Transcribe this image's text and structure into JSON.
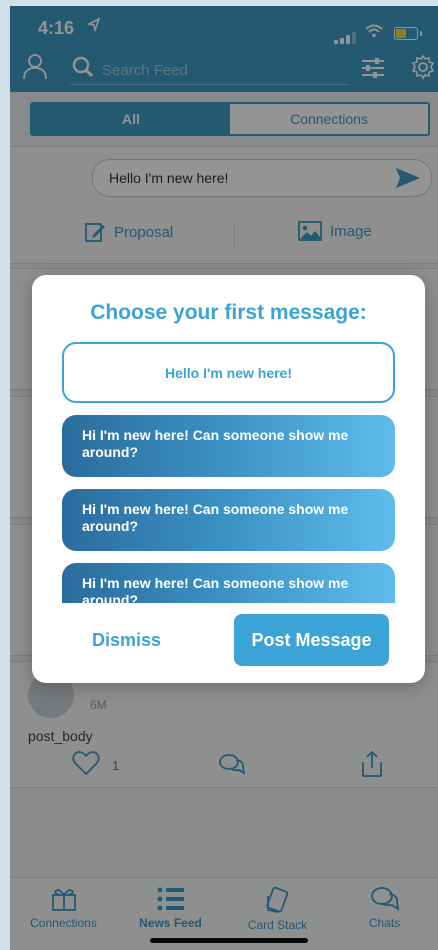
{
  "status_bar": {
    "time": "4:16"
  },
  "header": {
    "search_placeholder": "Search Feed"
  },
  "segments": [
    {
      "label": "All",
      "active": true
    },
    {
      "label": "Connections",
      "active": false
    }
  ],
  "composer": {
    "text": "Hello I'm new here!",
    "attachments": [
      {
        "label": "Proposal",
        "icon": "edit-document-icon"
      },
      {
        "label": "Image",
        "icon": "image-icon"
      }
    ]
  },
  "post": {
    "time_ago": "6M",
    "body": "post_body",
    "like_count": "1"
  },
  "tabbar": {
    "tabs": [
      {
        "label": "Connections",
        "icon": "gift-icon",
        "active": false
      },
      {
        "label": "News Feed",
        "icon": "list-icon",
        "active": true
      },
      {
        "label": "Card Stack",
        "icon": "cards-icon",
        "active": false
      },
      {
        "label": "Chats",
        "icon": "chat-bubbles-icon",
        "active": false
      }
    ]
  },
  "modal": {
    "title": "Choose your first message:",
    "options": [
      {
        "text": "Hello I'm new here!",
        "selected": true
      },
      {
        "text": "Hi I'm new here! Can someone show me around?",
        "selected": false
      },
      {
        "text": "Hi I'm new here! Can someone show me around?",
        "selected": false
      },
      {
        "text": "Hi I'm new here! Can someone show me around?",
        "selected": false
      }
    ],
    "dismiss_label": "Dismiss",
    "post_label": "Post Message"
  },
  "colors": {
    "header_blue": "#3f9ac4",
    "accent": "#3ba3d6",
    "battery": "#f4dc32"
  }
}
